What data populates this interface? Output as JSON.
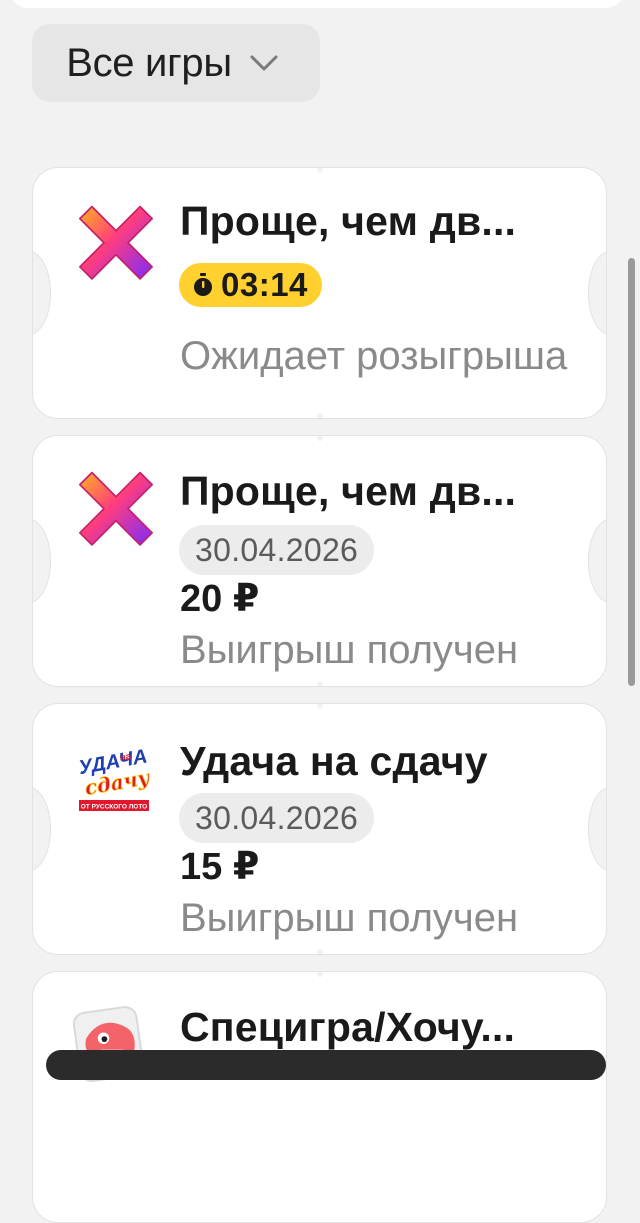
{
  "filter": {
    "label": "Все игры"
  },
  "tickets": [
    {
      "game": "Проще, чем дв...",
      "timer": "03:14",
      "status": "Ожидает розыгрыша"
    },
    {
      "game": "Проще, чем дв...",
      "date": "30.04.2026",
      "amount": "20 ₽",
      "status": "Выигрыш получен"
    },
    {
      "game": "Удача на сдачу",
      "logo_text": {
        "top": "УДАЧА",
        "mid": "на",
        "script": "сдачу",
        "bottom": "ОТ РУССКОГО ЛОТО"
      },
      "date": "30.04.2026",
      "amount": "15 ₽",
      "status": "Выигрыш получен"
    },
    {
      "game": "Специгра/Хочу..."
    }
  ],
  "colors": {
    "timer_badge": "#ffd02e",
    "status_text": "#8a8a8a",
    "page_bg": "#f2f2f2"
  }
}
